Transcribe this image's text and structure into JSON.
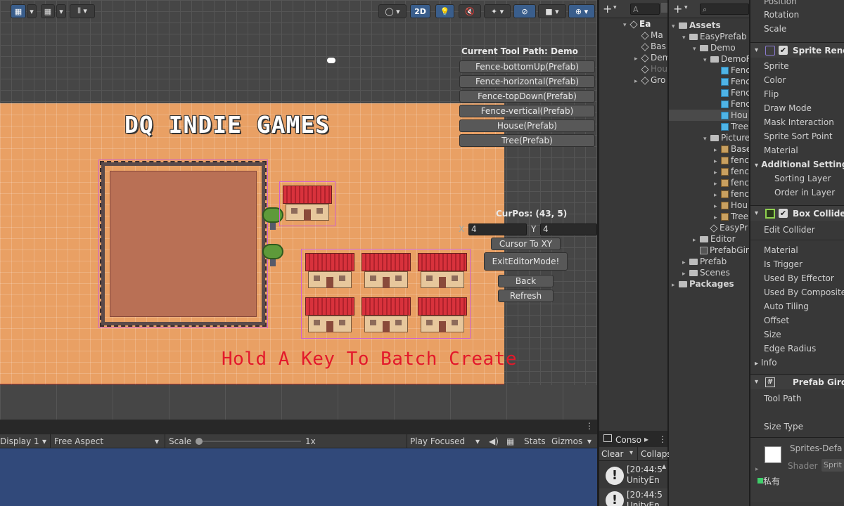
{
  "scene": {
    "title_text": "DQ INDIE GAMES",
    "hint_text": "Hold A Key To Batch Create",
    "toolbar": {
      "mode_2d": "2D"
    },
    "tool_path_label": "Current Tool Path: Demo",
    "prefab_buttons": [
      "Fence-bottomUp(Prefab)",
      "Fence-horizontal(Prefab)",
      "Fence-topDown(Prefab)",
      "Fence-vertical(Prefab)",
      "House(Prefab)",
      "Tree(Prefab)"
    ],
    "curpos_label": "CurPos: (43, 5)",
    "x_label": "X",
    "x_value": "4",
    "y_label": "Y",
    "y_value": "4",
    "cursor_btn": "Cursor To XY",
    "exit_btn": "ExitEditorMode!",
    "back_btn": "Back",
    "refresh_btn": "Refresh"
  },
  "gamebar": {
    "display": "Display 1",
    "aspect": "Free Aspect",
    "scale_label": "Scale",
    "scale_value": "1x",
    "play_focused": "Play Focused",
    "stats": "Stats",
    "gizmos": "Gizmos"
  },
  "hierarchy": {
    "search_placeholder": "A",
    "items": [
      "Ea",
      "Ma",
      "Bas",
      "Dem",
      "Hou",
      "Gro"
    ]
  },
  "project": {
    "items": [
      {
        "label": "Assets",
        "level": 0,
        "type": "folder",
        "bold": true
      },
      {
        "label": "EasyPrefab",
        "level": 1,
        "type": "folder"
      },
      {
        "label": "Demo",
        "level": 2,
        "type": "folder"
      },
      {
        "label": "DemoF",
        "level": 3,
        "type": "folder"
      },
      {
        "label": "Fenc",
        "level": 4,
        "type": "prefab"
      },
      {
        "label": "Fenc",
        "level": 4,
        "type": "prefab"
      },
      {
        "label": "Fenc",
        "level": 4,
        "type": "prefab"
      },
      {
        "label": "Fenc",
        "level": 4,
        "type": "prefab"
      },
      {
        "label": "Hou",
        "level": 4,
        "type": "prefab"
      },
      {
        "label": "Tree",
        "level": 4,
        "type": "prefab"
      },
      {
        "label": "Picture",
        "level": 3,
        "type": "folder"
      },
      {
        "label": "Base",
        "level": 4,
        "type": "sprite"
      },
      {
        "label": "fenc",
        "level": 4,
        "type": "sprite"
      },
      {
        "label": "fenc",
        "level": 4,
        "type": "sprite"
      },
      {
        "label": "fenc",
        "level": 4,
        "type": "sprite"
      },
      {
        "label": "fenc",
        "level": 4,
        "type": "sprite"
      },
      {
        "label": "Hou",
        "level": 4,
        "type": "sprite"
      },
      {
        "label": "Tree",
        "level": 4,
        "type": "sprite"
      },
      {
        "label": "EasyPr",
        "level": 3,
        "type": "scene"
      },
      {
        "label": "Editor",
        "level": 2,
        "type": "folder"
      },
      {
        "label": "PrefabGir",
        "level": 2,
        "type": "script"
      },
      {
        "label": "Prefab",
        "level": 1,
        "type": "folder"
      },
      {
        "label": "Scenes",
        "level": 1,
        "type": "folder"
      },
      {
        "label": "Packages",
        "level": 0,
        "type": "folder",
        "bold": true
      }
    ]
  },
  "console": {
    "tab": "Conso",
    "clear": "Clear",
    "collapse": "Collaps",
    "entries": [
      {
        "time": "[20:44:5",
        "text": "UnityEn"
      },
      {
        "time": "[20:44:5",
        "text": "UnityEn"
      }
    ]
  },
  "inspector": {
    "transform_rows": [
      "Position",
      "Rotation",
      "Scale"
    ],
    "sprite_renderer": {
      "header": "Sprite Rende",
      "rows": [
        "Sprite",
        "Color",
        "Flip",
        "Draw Mode",
        "Mask Interaction",
        "Sprite Sort Point",
        "Material"
      ],
      "additional": "Additional Settings",
      "sub_rows": [
        "Sorting Layer",
        "Order in Layer"
      ]
    },
    "box_collider": {
      "header": "Box Collider",
      "edit_btn": "Edit Collider",
      "rows": [
        "Material",
        "Is Trigger",
        "Used By Effector",
        "Used By Composite",
        "Auto Tiling",
        "Offset",
        "Size",
        "Edge Radius",
        "Info"
      ]
    },
    "prefab_grid": {
      "header": "Prefab Gird",
      "rows": [
        "Tool Path",
        "Size Type"
      ]
    },
    "material": {
      "name": "Sprites-Defa",
      "shader_label": "Shader",
      "shader_value": "Sprit",
      "private_label": "私有"
    }
  },
  "colors": {
    "accent": "#3a5e8c",
    "scene_ground": "#e9a064",
    "hint_red": "#e3192b",
    "game_bg": "#31497a"
  }
}
